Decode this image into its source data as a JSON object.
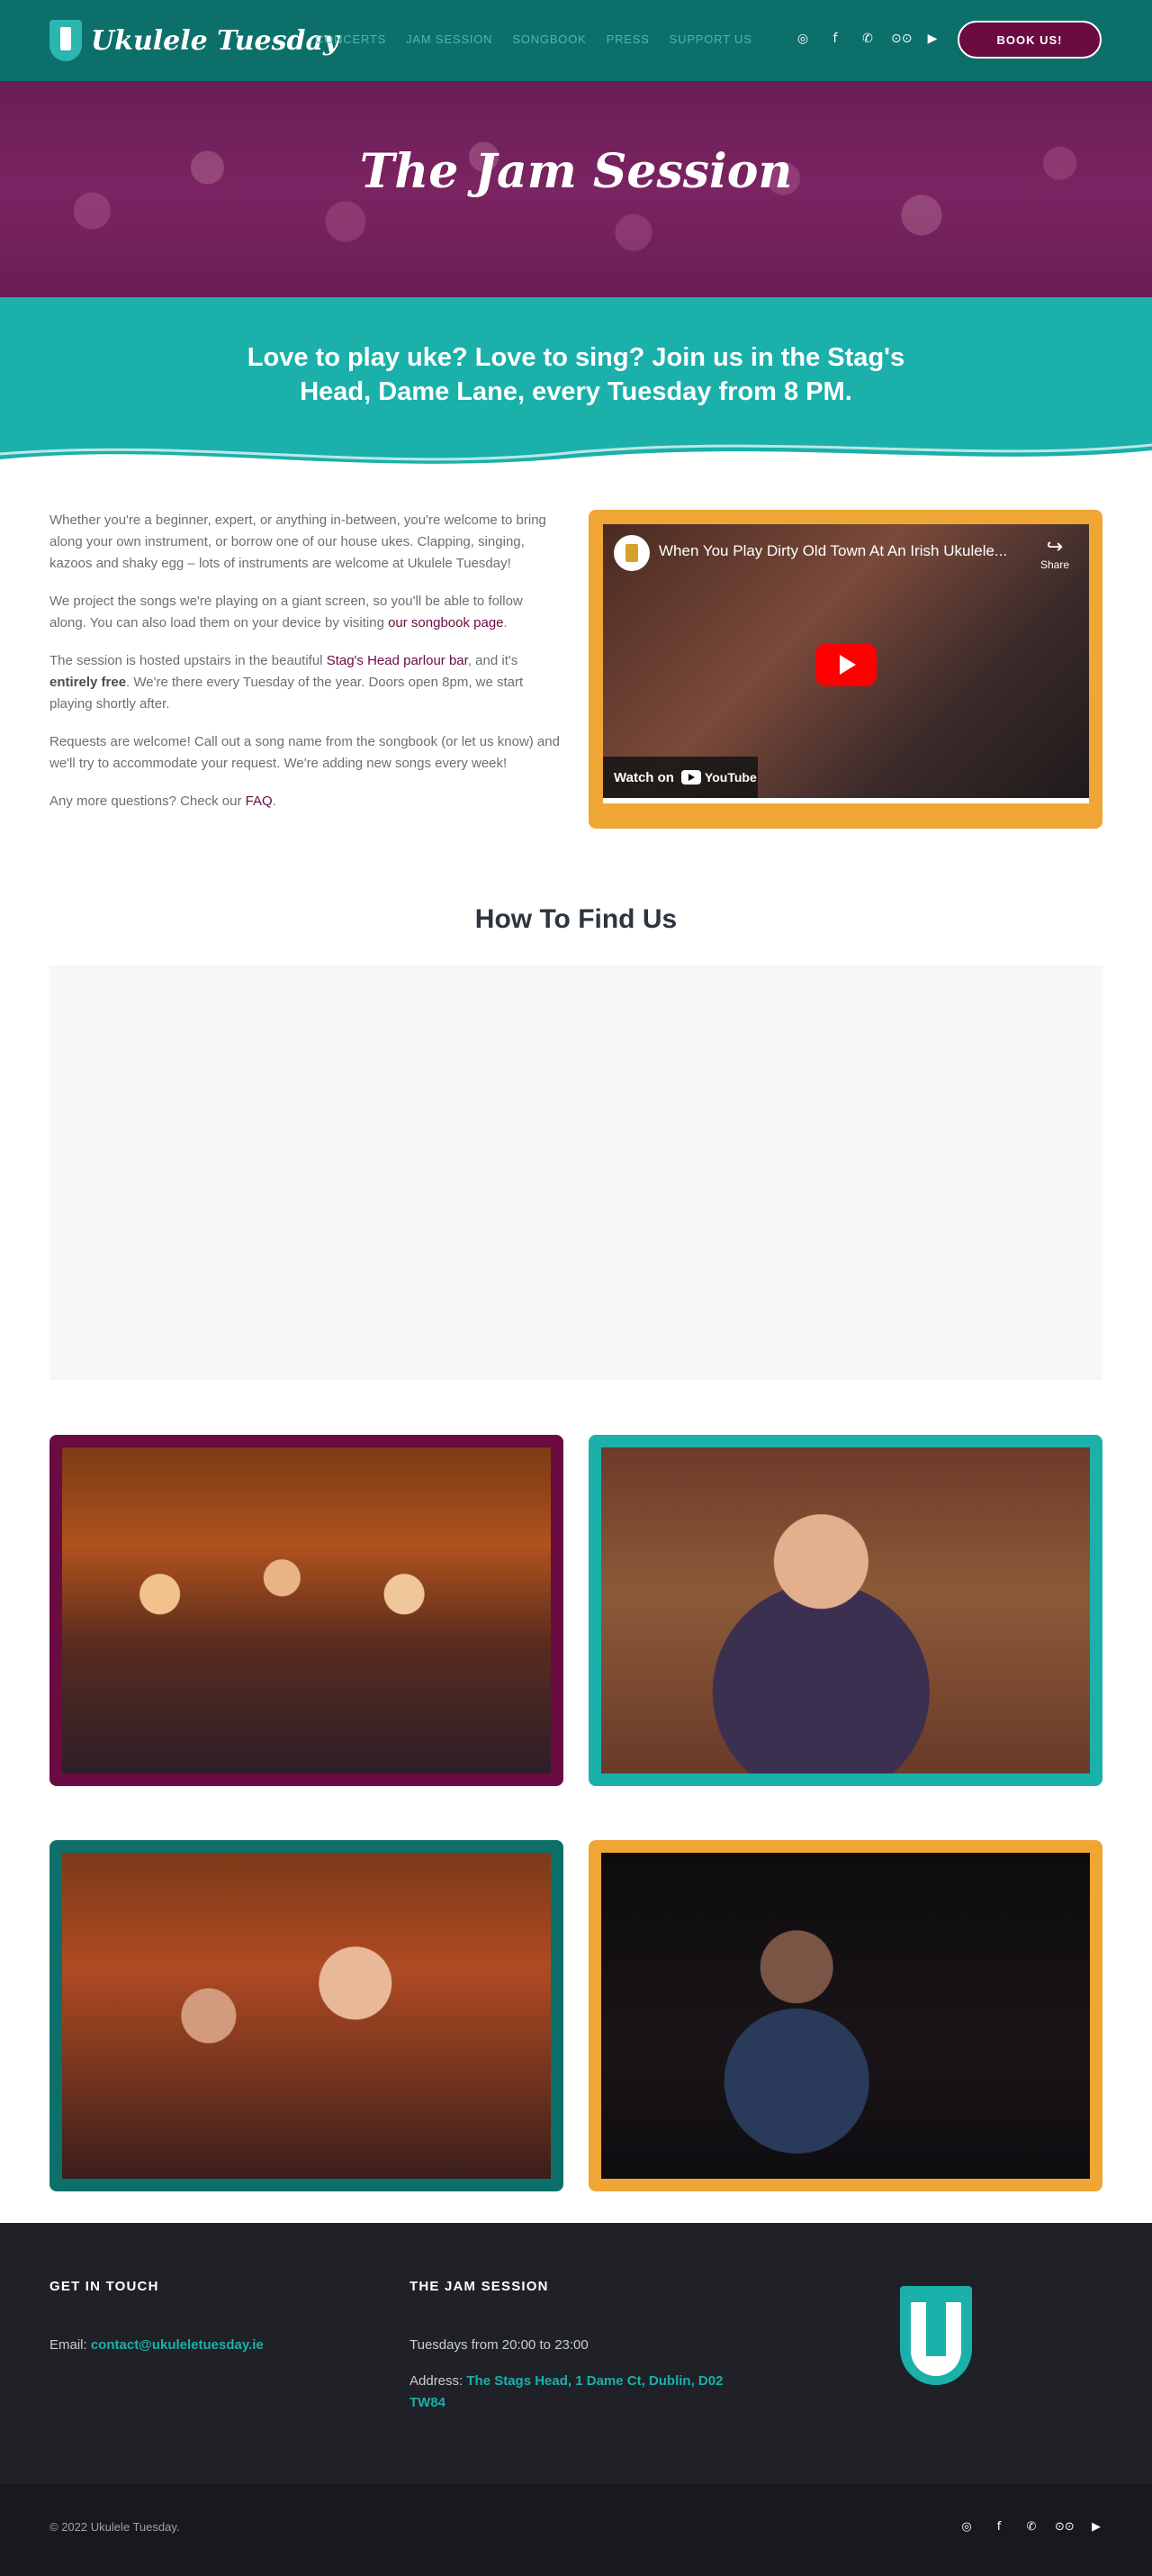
{
  "header": {
    "brand": "Ukulele Tuesday",
    "nav": [
      {
        "label": "CONCERTS"
      },
      {
        "label": "JAM SESSION"
      },
      {
        "label": "SONGBOOK"
      },
      {
        "label": "PRESS"
      },
      {
        "label": "SUPPORT US"
      }
    ],
    "social_icons": [
      "instagram-icon",
      "facebook-icon",
      "whatsapp-icon",
      "tripadvisor-icon",
      "youtube-icon"
    ],
    "book_label": "BOOK US!"
  },
  "hero": {
    "title": "The Jam Session"
  },
  "band": {
    "text": "Love to play uke? Love to sing? Join us in the Stag's Head, Dame Lane, every Tuesday from 8 PM."
  },
  "intro": {
    "p1": "Whether you're a beginner, expert, or anything in-between, you're welcome to bring along your own instrument, or borrow one of our house ukes. Clapping, singing, kazoos and shaky egg – lots of instruments are welcome at Ukulele Tuesday!",
    "p2_pre": "We project the songs we're playing on a giant screen, so you'll be able to follow along. You can also load them on your device by visiting ",
    "p2_link": "our songbook page",
    "p2_post": ".",
    "p3_pre": "The session is hosted upstairs in the beautiful ",
    "p3_link": "Stag's Head parlour bar",
    "p3_mid": ", and it's ",
    "p3_bold": "entirely free",
    "p3_post": ". We're there every Tuesday of the year. Doors open 8pm, we start playing shortly after.",
    "p4": "Requests are welcome! Call out a song name from the songbook (or let us know) and we'll try to accommodate your request. We're adding new songs every week!",
    "p5_pre": "Any more questions? Check our ",
    "p5_link": "FAQ",
    "p5_post": "."
  },
  "video": {
    "title": "When You Play Dirty Old Town At An Irish Ukulele...",
    "share_label": "Share",
    "watch_on": "Watch on",
    "youtube_label": "YouTube"
  },
  "find_us": {
    "title": "How To Find Us"
  },
  "footer": {
    "contact_head": "GET IN TOUCH",
    "email_label": "Email: ",
    "email": "contact@ukuleletuesday.ie",
    "jam_head": "THE JAM SESSION",
    "hours": "Tuesdays from 20:00 to 23:00",
    "address_label": "Address: ",
    "address": "The Stags Head, 1 Dame Ct, Dublin, D02 TW84",
    "copyright": "© 2022 Ukulele Tuesday."
  },
  "colors": {
    "header_bg": "#0d6f6a",
    "accent_teal": "#1bb0aa",
    "accent_plum": "#6a0b42",
    "accent_orange": "#f0a635",
    "footer_bg": "#1f2127"
  }
}
